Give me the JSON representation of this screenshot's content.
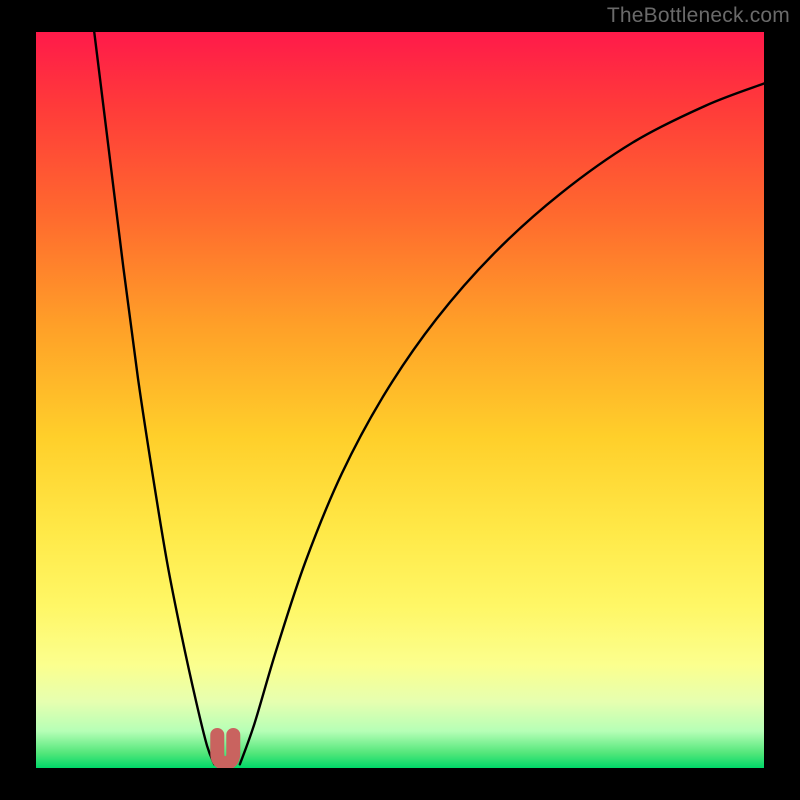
{
  "watermark": {
    "text": "TheBottleneck.com"
  },
  "colors": {
    "frame": "#000000",
    "curve": "#000000",
    "marker": "#c9635f",
    "gradient_top": "#ff1a4a",
    "gradient_bottom": "#00d868"
  },
  "chart_data": {
    "type": "line",
    "title": "",
    "xlabel": "",
    "ylabel": "",
    "xlim": [
      0,
      100
    ],
    "ylim": [
      0,
      100
    ],
    "grid": false,
    "legend": false,
    "series": [
      {
        "name": "left-branch",
        "x": [
          8,
          10,
          12,
          14,
          16,
          18,
          20,
          22,
          23.5,
          24.5
        ],
        "y": [
          100,
          84,
          68,
          53,
          40,
          28,
          18,
          9,
          3,
          0.5
        ]
      },
      {
        "name": "right-branch",
        "x": [
          28,
          30,
          33,
          37,
          42,
          48,
          55,
          63,
          72,
          82,
          92,
          100
        ],
        "y": [
          0.5,
          6,
          16,
          28,
          40,
          51,
          61,
          70,
          78,
          85,
          90,
          93
        ]
      }
    ],
    "annotations": [
      {
        "name": "u-marker",
        "x": 26,
        "y": 1.5,
        "shape": "U",
        "color": "#c9635f"
      }
    ]
  }
}
